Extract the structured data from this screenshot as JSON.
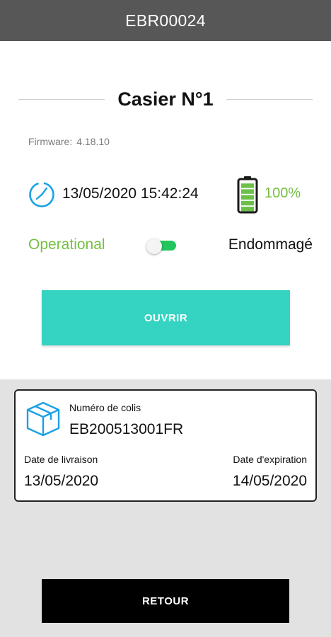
{
  "appbar": {
    "title": "EBR00024"
  },
  "locker": {
    "title": "Casier N°1",
    "firmware_label": "Firmware:",
    "firmware_value": "4.18.10",
    "datetime": "13/05/2020 15:42:24",
    "battery_percent": "100%",
    "battery_level": 1.0,
    "status_operational": "Operational",
    "status_damaged": "Endommagé",
    "toggle_on": true,
    "open_button": "OUVRIR"
  },
  "parcel": {
    "number_label": "Numéro de colis",
    "number_value": "EB200513001FR",
    "delivery_label": "Date de livraison",
    "delivery_value": "13/05/2020",
    "expiry_label": "Date d'expiration",
    "expiry_value": "14/05/2020"
  },
  "back_button": "RETOUR",
  "icons": {
    "clock": "clock-icon",
    "battery": "battery-full-icon",
    "package": "package-box-icon"
  },
  "colors": {
    "accent": "#35d3c1",
    "status_green": "#74bf44",
    "clock_blue": "#1ba1e2",
    "appbar": "#575757"
  }
}
